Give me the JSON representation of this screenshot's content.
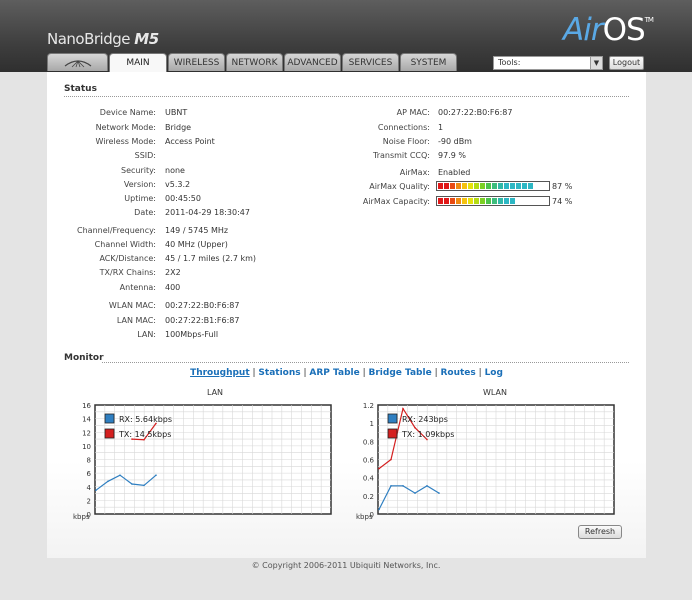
{
  "header": {
    "brand_name": "NanoBridge",
    "brand_model": "M5",
    "airos_air": "Air",
    "airos_os": "OS",
    "airos_tm": "TM"
  },
  "tabs": [
    {
      "label": "MAIN"
    },
    {
      "label": "WIRELESS"
    },
    {
      "label": "NETWORK"
    },
    {
      "label": "ADVANCED"
    },
    {
      "label": "SERVICES"
    },
    {
      "label": "SYSTEM"
    }
  ],
  "tools": {
    "value": "Tools:"
  },
  "logout_label": "Logout",
  "status": {
    "title": "Status",
    "left": [
      {
        "label": "Device Name:",
        "value": "UBNT"
      },
      {
        "label": "Network Mode:",
        "value": "Bridge"
      },
      {
        "label": "Wireless Mode:",
        "value": "Access Point"
      },
      {
        "label": "SSID:",
        "value": ""
      },
      {
        "label": "Security:",
        "value": "none"
      },
      {
        "label": "Version:",
        "value": "v5.3.2"
      },
      {
        "label": "Uptime:",
        "value": "00:45:50"
      },
      {
        "label": "Date:",
        "value": "2011-04-29 18:30:47"
      },
      {
        "label": "Channel/Frequency:",
        "value": "149 / 5745 MHz"
      },
      {
        "label": "Channel Width:",
        "value": "40 MHz (Upper)"
      },
      {
        "label": "ACK/Distance:",
        "value": "45 / 1.7 miles (2.7 km)"
      },
      {
        "label": "TX/RX Chains:",
        "value": "2X2"
      },
      {
        "label": "Antenna:",
        "value": "400"
      },
      {
        "label": "WLAN MAC:",
        "value": "00:27:22:B0:F6:87"
      },
      {
        "label": "LAN MAC:",
        "value": "00:27:22:B1:F6:87"
      },
      {
        "label": "LAN:",
        "value": "100Mbps-Full"
      }
    ],
    "right": [
      {
        "label": "AP MAC:",
        "value": "00:27:22:B0:F6:87"
      },
      {
        "label": "Connections:",
        "value": "1"
      },
      {
        "label": "Noise Floor:",
        "value": "-90 dBm"
      },
      {
        "label": "Transmit CCQ:",
        "value": "97.9 %"
      },
      {
        "label": "AirMax:",
        "value": "Enabled"
      },
      {
        "label": "AirMax Quality:",
        "value": "87 %"
      },
      {
        "label": "AirMax Capacity:",
        "value": "74 %"
      }
    ],
    "airmax_quality": 0.87,
    "airmax_capacity": 0.74
  },
  "monitor": {
    "title": "Monitor",
    "links": [
      "Throughput",
      "Stations",
      "ARP Table",
      "Bridge Table",
      "Routes",
      "Log"
    ],
    "refresh_label": "Refresh"
  },
  "chart_data": [
    {
      "type": "line",
      "title": "LAN",
      "ylabel": "kbps",
      "y_ticks": [
        "16",
        "14",
        "12",
        "10",
        "8",
        "6",
        "4",
        "2",
        "0"
      ],
      "ylim": [
        0,
        16
      ],
      "grid": true,
      "legend_position": "top-left",
      "x": [
        0,
        1,
        2,
        3,
        4,
        5
      ],
      "series": [
        {
          "name": "RX: 5.64kbps",
          "color": "#2f7fc1",
          "values": [
            3.5,
            4.8,
            5.7,
            4.4,
            4.2,
            5.7
          ]
        },
        {
          "name": "TX: 14.5kbps",
          "color": "#d42020",
          "values": [
            null,
            null,
            null,
            11.0,
            10.9,
            13.3
          ]
        }
      ]
    },
    {
      "type": "line",
      "title": "WLAN",
      "ylabel": "kbps",
      "y_ticks": [
        "1.2",
        "1",
        "0.8",
        "0.6",
        "0.4",
        "0.2",
        "0"
      ],
      "ylim": [
        0,
        1.2
      ],
      "grid": true,
      "legend_position": "top-left",
      "x": [
        0,
        1,
        2,
        3,
        4,
        5
      ],
      "series": [
        {
          "name": "RX: 243bps",
          "color": "#2f7fc1",
          "values": [
            0.05,
            0.31,
            0.31,
            0.23,
            0.31,
            0.23
          ]
        },
        {
          "name": "TX: 1.09kbps",
          "color": "#d42020",
          "values": [
            0.5,
            0.6,
            1.16,
            0.95,
            0.82,
            null
          ]
        }
      ]
    }
  ],
  "footer": "© Copyright 2006-2011 Ubiquiti Networks, Inc."
}
